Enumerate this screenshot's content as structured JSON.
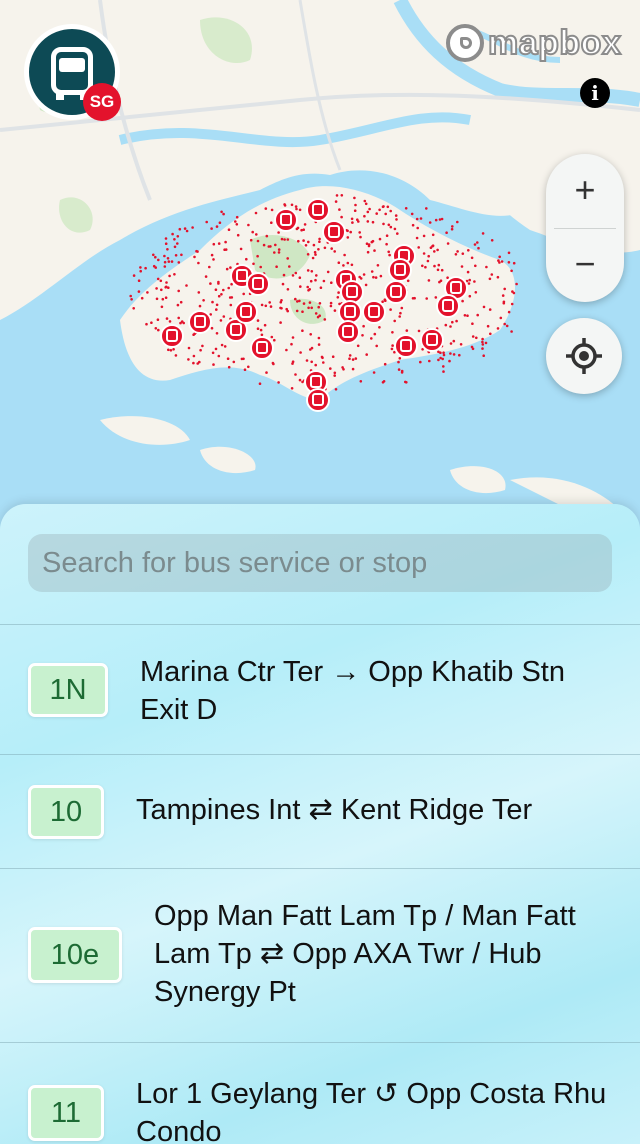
{
  "app": {
    "logo_badge": "SG",
    "attribution_brand": "mapbox",
    "info_glyph": "i",
    "zoom_in_label": "+",
    "zoom_out_label": "−",
    "accent_color": "#e3122c",
    "logo_color": "#0d4a55"
  },
  "search": {
    "placeholder": "Search for bus service or stop"
  },
  "services": [
    {
      "number": "1N",
      "route": "Marina Ctr Ter → Opp Khatib Stn Exit D"
    },
    {
      "number": "10",
      "route": "Tampines Int ⇄ Kent Ridge Ter"
    },
    {
      "number": "10e",
      "route": "Opp Man Fatt Lam Tp / Man Fatt Lam Tp ⇄ Opp AXA Twr / Hub Synergy Pt"
    },
    {
      "number": "11",
      "route": "Lor 1 Geylang Ter ↺ Opp Costa Rhu Condo"
    }
  ]
}
